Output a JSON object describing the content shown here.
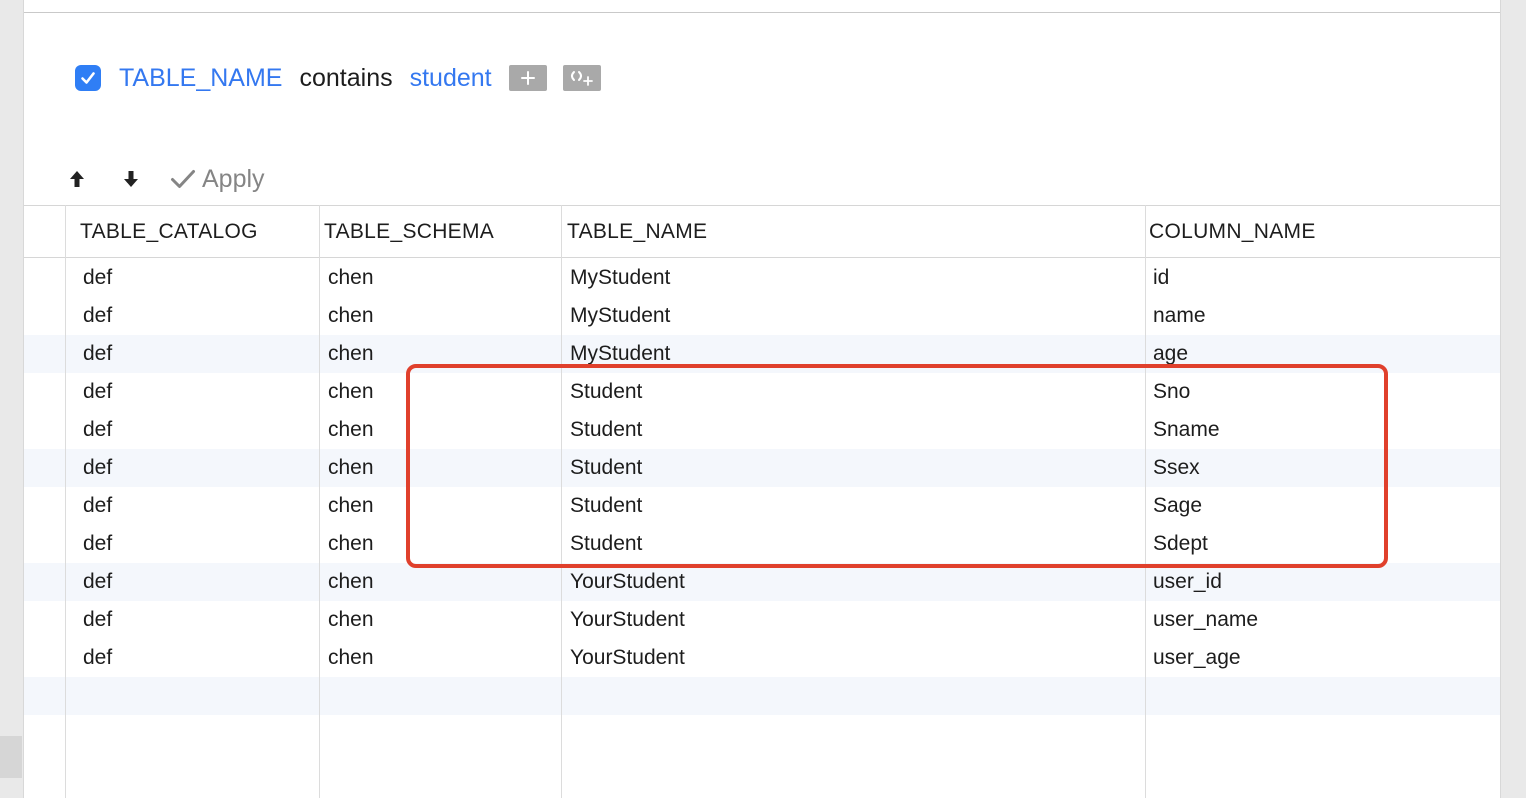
{
  "filter": {
    "enabled": true,
    "field": "TABLE_NAME",
    "operator": "contains",
    "value": "student",
    "add_icon": "plus-icon",
    "add_subquery_icon": "bracket-plus-icon"
  },
  "toolbar": {
    "move_up_icon": "arrow-up-icon",
    "move_down_icon": "arrow-down-icon",
    "apply_label": "Apply"
  },
  "colors": {
    "accent": "#2f7ef5",
    "link": "#3478f0",
    "highlight": "#e0402c",
    "row_alt": "#f4f7fc"
  },
  "grid": {
    "columns": [
      "TABLE_CATALOG",
      "TABLE_SCHEMA",
      "TABLE_NAME",
      "COLUMN_NAME"
    ],
    "rows": [
      [
        "def",
        "chen",
        "MyStudent",
        "id"
      ],
      [
        "def",
        "chen",
        "MyStudent",
        "name"
      ],
      [
        "def",
        "chen",
        "MyStudent",
        "age"
      ],
      [
        "def",
        "chen",
        "Student",
        "Sno"
      ],
      [
        "def",
        "chen",
        "Student",
        "Sname"
      ],
      [
        "def",
        "chen",
        "Student",
        "Ssex"
      ],
      [
        "def",
        "chen",
        "Student",
        "Sage"
      ],
      [
        "def",
        "chen",
        "Student",
        "Sdept"
      ],
      [
        "def",
        "chen",
        "YourStudent",
        "user_id"
      ],
      [
        "def",
        "chen",
        "YourStudent",
        "user_name"
      ],
      [
        "def",
        "chen",
        "YourStudent",
        "user_age"
      ]
    ],
    "alt_rows": [
      2,
      5,
      8,
      11
    ],
    "highlighted_rows": [
      3,
      4,
      5,
      6,
      7
    ]
  }
}
